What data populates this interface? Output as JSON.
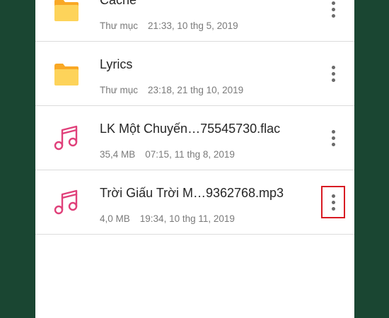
{
  "files": [
    {
      "title": "Cache",
      "type_label": "Thư mục",
      "timestamp": "21:33, 10 thg 5, 2019",
      "icon": "folder-icon"
    },
    {
      "title": "Lyrics",
      "type_label": "Thư mục",
      "timestamp": "23:18, 21 thg 10, 2019",
      "icon": "folder-icon"
    },
    {
      "title": "LK Một Chuyến…75545730.flac",
      "type_label": "35,4 MB",
      "timestamp": "07:15, 11 thg 8, 2019",
      "icon": "music-note-icon"
    },
    {
      "title": "Trời Giấu Trời M…9362768.mp3",
      "type_label": "4,0 MB",
      "timestamp": "19:34, 10 thg 11, 2019",
      "icon": "music-note-icon"
    }
  ],
  "colors": {
    "background": "#1a4632",
    "folder": "#fbc02d",
    "music": "#e0407a",
    "highlight": "#d81b23"
  }
}
